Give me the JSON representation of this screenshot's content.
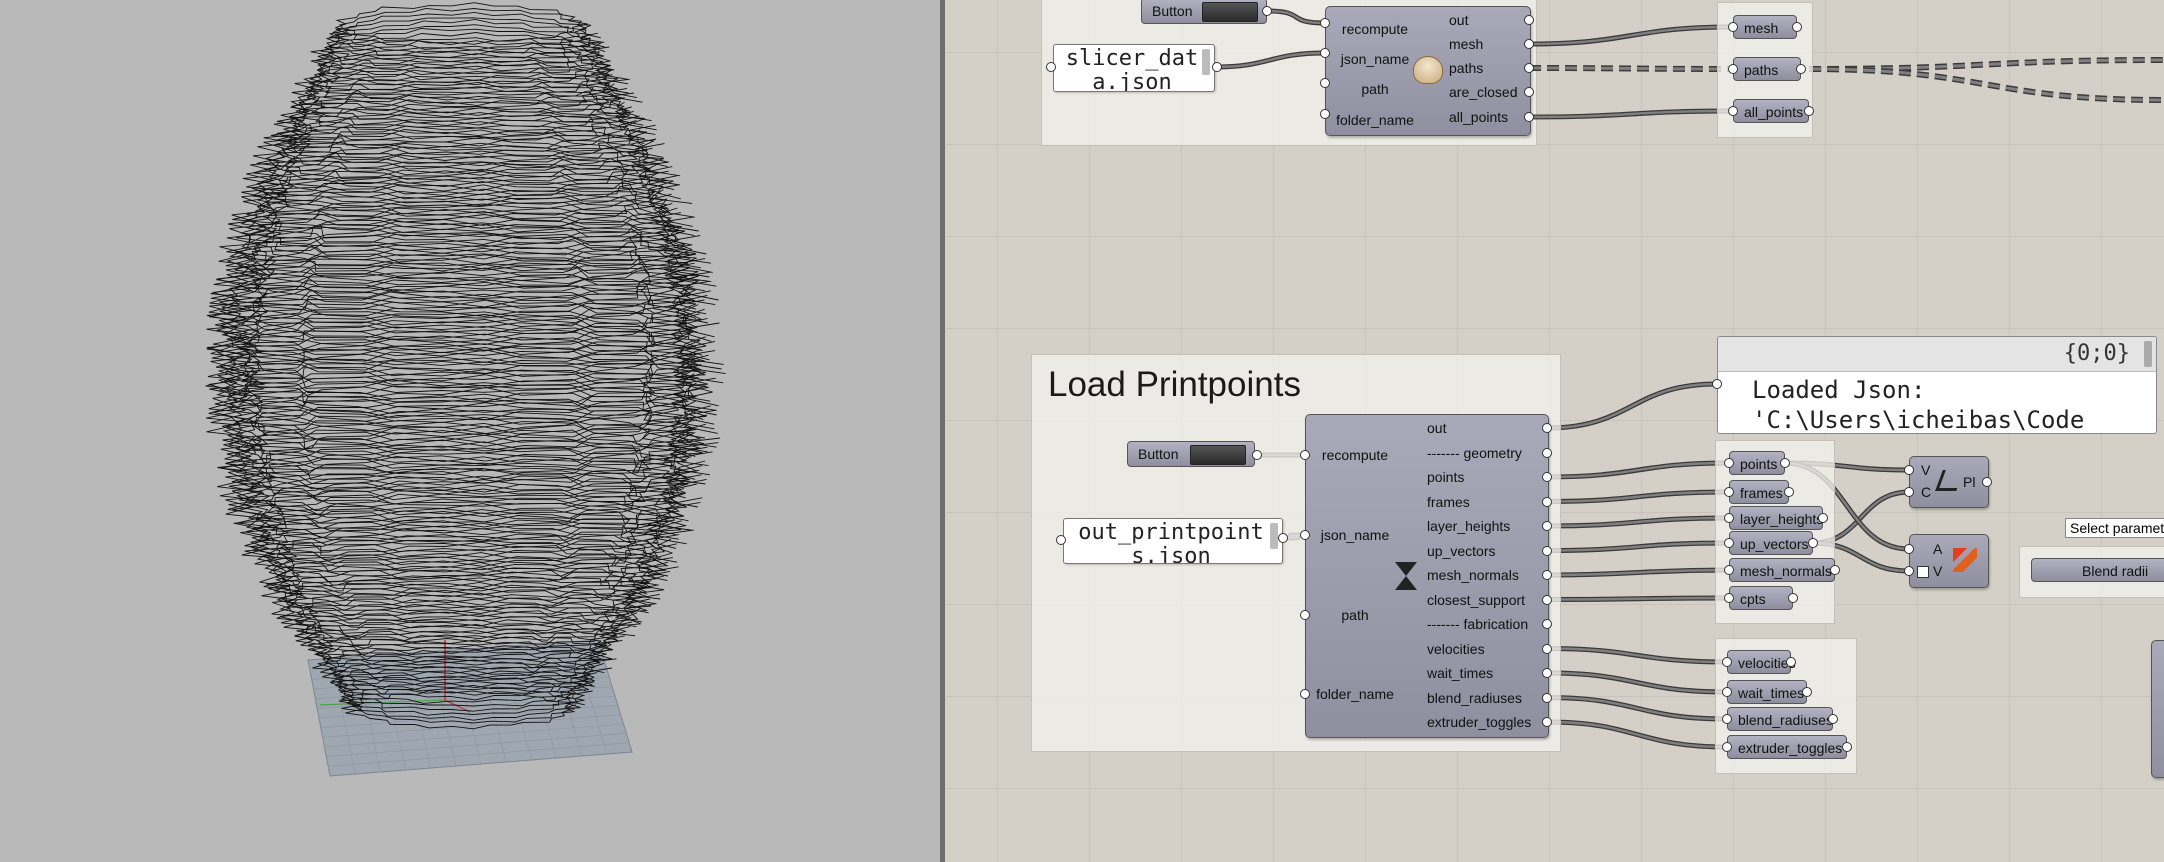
{
  "viewport": {
    "name": "Rhino perspective viewport"
  },
  "canvas": {
    "top_group": {
      "button_label": "Button",
      "json_panel_text": "slicer_data.json",
      "component": {
        "inputs": [
          "recompute",
          "json_name",
          "path",
          "folder_name"
        ],
        "outputs": [
          "out",
          "mesh",
          "paths",
          "are_closed",
          "all_points"
        ],
        "icon": "slicer-icon"
      },
      "params": [
        "mesh",
        "paths",
        "all_points"
      ]
    },
    "printpoints_group": {
      "title": "Load Printpoints",
      "button_label": "Button",
      "json_panel_text": "out_printpoints.json",
      "component": {
        "inputs": [
          "recompute",
          "json_name",
          "path",
          "folder_name"
        ],
        "outputs": [
          "out",
          "------- geometry",
          "points",
          "frames",
          "layer_heights",
          "up_vectors",
          "mesh_normals",
          "closest_support",
          "------- fabrication",
          "velocities",
          "wait_times",
          "blend_radiuses",
          "extruder_toggles"
        ],
        "icon": "printpoints-icon"
      },
      "geometry_params": [
        "points",
        "frames",
        "layer_heights",
        "up_vectors",
        "mesh_normals",
        "cpts"
      ],
      "fabrication_params": [
        "velocities",
        "wait_times",
        "blend_radiuses",
        "extruder_toggles"
      ]
    },
    "out_panel": {
      "header": "{0;0}",
      "line1": "Loaded Json:",
      "line2": "'C:\\Users\\icheibas\\Code"
    },
    "plane_comp": {
      "inputs": [
        "V",
        "C"
      ],
      "output": "Pl"
    },
    "vector_display_comp": {
      "inputs": [
        "A",
        "V"
      ]
    },
    "tooltip": "Select paramete",
    "blend_param": "Blend radii"
  }
}
